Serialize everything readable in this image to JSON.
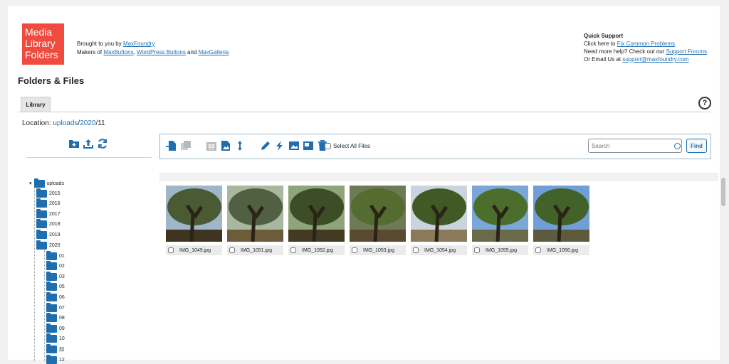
{
  "brand": {
    "logo_line1": "Media",
    "logo_line2": "Library",
    "logo_line3": "Folders"
  },
  "credits": {
    "brought_prefix": "Brought to you by ",
    "brought_link": "MaxFoundry",
    "makers_prefix": "Makers of ",
    "makers_link1": "MaxButtons",
    "sep1": ", ",
    "makers_link2": "WordPress Buttons",
    "sep2": " and ",
    "makers_link3": "MaxGalleria"
  },
  "support": {
    "title": "Quick Support",
    "line1_prefix": "Click here to ",
    "line1_link": "Fix Common Problems",
    "line2_prefix": "Need more help? Check out our ",
    "line2_link": "Support Forums",
    "line3_prefix": "Or Email Us at ",
    "line3_link": "support@maxfoundry.com"
  },
  "page": {
    "heading": "Folders & Files",
    "tab_library": "Library",
    "help": "?"
  },
  "location": {
    "label": "Location: ",
    "part1": "uploads",
    "sep1": "/",
    "part2": "2020",
    "sep2": "/",
    "part3": "11"
  },
  "tree": {
    "root": "uploads",
    "years": [
      "2015",
      "2016",
      "2017",
      "2018",
      "2019",
      "2020"
    ],
    "months": [
      "01",
      "02",
      "03",
      "05",
      "06",
      "07",
      "08",
      "09",
      "10",
      "11",
      "12"
    ],
    "selected": "11"
  },
  "toolbar": {
    "select_all": "Select All Files",
    "search_placeholder": "Search",
    "find": "Find"
  },
  "files": [
    "IMG_1049.jpg",
    "IMG_1051.jpg",
    "IMG_1052.jpg",
    "IMG_1053.jpg",
    "IMG_1054.jpg",
    "IMG_1055.jpg",
    "IMG_1056.jpg"
  ],
  "colors": {
    "accent": "#1f6fb0",
    "logo": "#ef4b3e",
    "link": "#2271b1"
  }
}
